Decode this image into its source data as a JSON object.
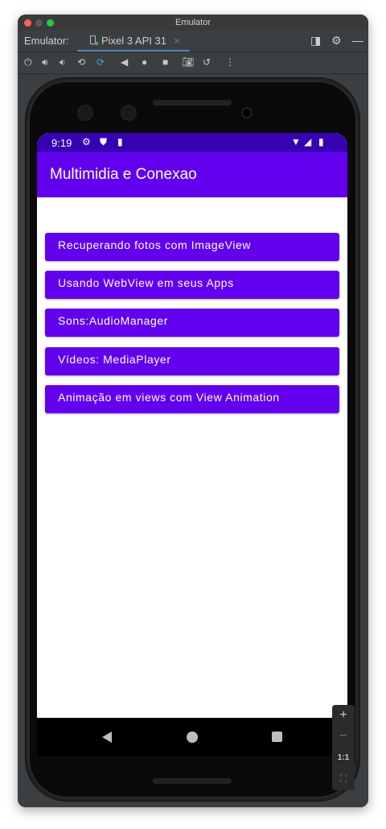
{
  "window": {
    "title": "Emulator",
    "tab_label": "Emulator:",
    "device_tab": "Pixel 3 API 31",
    "tab_close": "×"
  },
  "toolbar": {
    "icons": [
      "power-icon",
      "volume-up-icon",
      "volume-down-icon",
      "rotate-left-icon",
      "rotate-right-icon",
      "back-icon",
      "home-icon",
      "overview-icon",
      "camera-icon",
      "history-icon",
      "more-icon"
    ]
  },
  "phone": {
    "status_time": "9:19",
    "app_title": "Multimidia e Conexao",
    "colors": {
      "status": "#3700b3",
      "appbar": "#6200ee",
      "button": "#6200ee"
    },
    "buttons": [
      "Recuperando fotos com ImageView",
      "Usando WebView em seus Apps",
      "Sons:AudioManager",
      "Vídeos: MediaPlayer",
      "Animação em views com View Animation"
    ]
  },
  "zoom": {
    "plus": "+",
    "minus": "−",
    "ratio": "1:1"
  }
}
